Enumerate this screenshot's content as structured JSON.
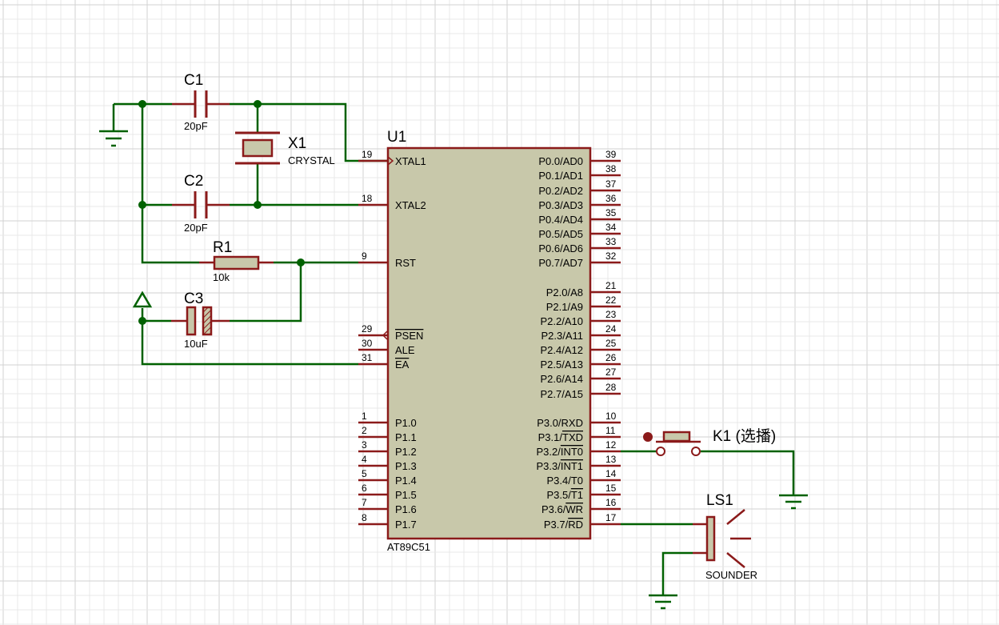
{
  "colors": {
    "grid_minor": "#e8e8e8",
    "grid_major": "#d2d2d2",
    "wire": "#006100",
    "component": "#8b1a1a",
    "chip_fill": "#c8c8aa",
    "junction": "#006100",
    "text": "#000000"
  },
  "components": {
    "c1": {
      "ref": "C1",
      "value": "20pF"
    },
    "c2": {
      "ref": "C2",
      "value": "20pF"
    },
    "c3": {
      "ref": "C3",
      "value": "10uF"
    },
    "x1": {
      "ref": "X1",
      "value": "CRYSTAL"
    },
    "r1": {
      "ref": "R1",
      "value": "10k"
    },
    "u1": {
      "ref": "U1",
      "value": "AT89C51"
    },
    "k1": {
      "ref": "K1 (选播)"
    },
    "ls1": {
      "ref": "LS1",
      "value": "SOUNDER"
    }
  },
  "u1_left_pins": [
    {
      "num": "19",
      "name": "XTAL1"
    },
    {
      "num": "18",
      "name": "XTAL2"
    },
    {
      "num": "9",
      "name": "RST"
    },
    {
      "num": "29",
      "name": "PSEN"
    },
    {
      "num": "30",
      "name": "ALE"
    },
    {
      "num": "31",
      "name": "EA"
    },
    {
      "num": "1",
      "name": "P1.0"
    },
    {
      "num": "2",
      "name": "P1.1"
    },
    {
      "num": "3",
      "name": "P1.2"
    },
    {
      "num": "4",
      "name": "P1.3"
    },
    {
      "num": "5",
      "name": "P1.4"
    },
    {
      "num": "6",
      "name": "P1.5"
    },
    {
      "num": "7",
      "name": "P1.6"
    },
    {
      "num": "8",
      "name": "P1.7"
    }
  ],
  "u1_right_pins": [
    {
      "num": "39",
      "name": "P0.0/AD0"
    },
    {
      "num": "38",
      "name": "P0.1/AD1"
    },
    {
      "num": "37",
      "name": "P0.2/AD2"
    },
    {
      "num": "36",
      "name": "P0.3/AD3"
    },
    {
      "num": "35",
      "name": "P0.4/AD4"
    },
    {
      "num": "34",
      "name": "P0.5/AD5"
    },
    {
      "num": "33",
      "name": "P0.6/AD6"
    },
    {
      "num": "32",
      "name": "P0.7/AD7"
    },
    {
      "num": "21",
      "name": "P2.0/A8"
    },
    {
      "num": "22",
      "name": "P2.1/A9"
    },
    {
      "num": "23",
      "name": "P2.2/A10"
    },
    {
      "num": "24",
      "name": "P2.3/A11"
    },
    {
      "num": "25",
      "name": "P2.4/A12"
    },
    {
      "num": "26",
      "name": "P2.5/A13"
    },
    {
      "num": "27",
      "name": "P2.6/A14"
    },
    {
      "num": "28",
      "name": "P2.7/A15"
    },
    {
      "num": "10",
      "name": "P3.0/RXD"
    },
    {
      "num": "11",
      "name": "P3.1/TXD"
    },
    {
      "num": "12",
      "name": "P3.2/INT0"
    },
    {
      "num": "13",
      "name": "P3.3/INT1"
    },
    {
      "num": "14",
      "name": "P3.4/T0"
    },
    {
      "num": "15",
      "name": "P3.5/T1"
    },
    {
      "num": "16",
      "name": "P3.6/WR"
    },
    {
      "num": "17",
      "name": "P3.7/RD"
    }
  ]
}
